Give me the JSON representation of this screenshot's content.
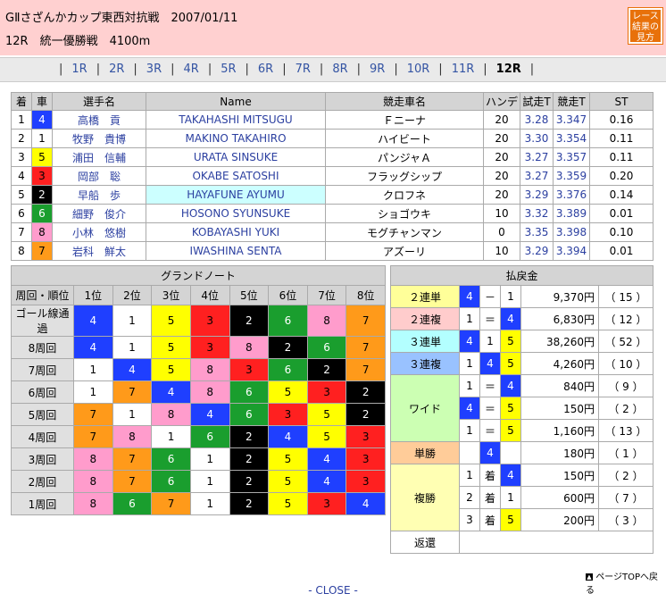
{
  "header": {
    "title": "GⅡさざんかカップ東西対抗戦　2007/01/11",
    "subtitle": "12R　統一優勝戦　4100m",
    "guide_label": "レース結果の見方"
  },
  "race_nav": {
    "races": [
      "1R",
      "2R",
      "3R",
      "4R",
      "5R",
      "6R",
      "7R",
      "8R",
      "9R",
      "10R",
      "11R",
      "12R"
    ],
    "current": "12R"
  },
  "entries": {
    "headers": [
      "着",
      "車",
      "選手名",
      "Name",
      "競走車名",
      "ハンデ",
      "試走T",
      "競走T",
      "ST"
    ],
    "rows": [
      {
        "rank": "1",
        "car": "4",
        "name": "高橋　貢",
        "name_en": "TAKAHASHI MITSUGU",
        "bike": "Ｆニーナ",
        "handi": "20",
        "trial": "3.28",
        "race": "3.347",
        "st": "0.16"
      },
      {
        "rank": "2",
        "car": "1",
        "name": "牧野　貴博",
        "name_en": "MAKINO TAKAHIRO",
        "bike": "ハイビート",
        "handi": "20",
        "trial": "3.30",
        "race": "3.354",
        "st": "0.11"
      },
      {
        "rank": "3",
        "car": "5",
        "name": "浦田　信輔",
        "name_en": "URATA SINSUKE",
        "bike": "パンジャＡ",
        "handi": "20",
        "trial": "3.27",
        "race": "3.357",
        "st": "0.11"
      },
      {
        "rank": "4",
        "car": "3",
        "name": "岡部　聡",
        "name_en": "OKABE SATOSHI",
        "bike": "フラッグシップ",
        "handi": "20",
        "trial": "3.27",
        "race": "3.359",
        "st": "0.20"
      },
      {
        "rank": "5",
        "car": "2",
        "name": "早船　歩",
        "name_en": "HAYAFUNE AYUMU",
        "bike": "クロフネ",
        "handi": "20",
        "trial": "3.29",
        "race": "3.376",
        "st": "0.14"
      },
      {
        "rank": "6",
        "car": "6",
        "name": "細野　俊介",
        "name_en": "HOSONO SYUNSUKE",
        "bike": "ショゴウキ",
        "handi": "10",
        "trial": "3.32",
        "race": "3.389",
        "st": "0.01"
      },
      {
        "rank": "7",
        "car": "8",
        "name": "小林　悠樹",
        "name_en": "KOBAYASHI YUKI",
        "bike": "モグチャンマン",
        "handi": "0",
        "trial": "3.35",
        "race": "3.398",
        "st": "0.10"
      },
      {
        "rank": "8",
        "car": "7",
        "name": "岩科　鮮太",
        "name_en": "IWASHINA SENTA",
        "bike": "アズーリ",
        "handi": "10",
        "trial": "3.29",
        "race": "3.394",
        "st": "0.01"
      }
    ]
  },
  "grand_note": {
    "title": "グランドノート",
    "col_label": "周回・順位",
    "positions": [
      "1位",
      "2位",
      "3位",
      "4位",
      "5位",
      "6位",
      "7位",
      "8位"
    ],
    "rows": [
      {
        "label": "ゴール線通過",
        "cars": [
          "4",
          "1",
          "5",
          "3",
          "2",
          "6",
          "8",
          "7"
        ]
      },
      {
        "label": "8周回",
        "cars": [
          "4",
          "1",
          "5",
          "3",
          "8",
          "2",
          "6",
          "7"
        ]
      },
      {
        "label": "7周回",
        "cars": [
          "1",
          "4",
          "5",
          "8",
          "3",
          "6",
          "2",
          "7"
        ]
      },
      {
        "label": "6周回",
        "cars": [
          "1",
          "7",
          "4",
          "8",
          "6",
          "5",
          "3",
          "2"
        ]
      },
      {
        "label": "5周回",
        "cars": [
          "7",
          "1",
          "8",
          "4",
          "6",
          "3",
          "5",
          "2"
        ]
      },
      {
        "label": "4周回",
        "cars": [
          "7",
          "8",
          "1",
          "6",
          "2",
          "4",
          "5",
          "3"
        ]
      },
      {
        "label": "3周回",
        "cars": [
          "8",
          "7",
          "6",
          "1",
          "2",
          "5",
          "4",
          "3"
        ]
      },
      {
        "label": "2周回",
        "cars": [
          "8",
          "7",
          "6",
          "1",
          "2",
          "5",
          "4",
          "3"
        ]
      },
      {
        "label": "1周回",
        "cars": [
          "8",
          "6",
          "7",
          "1",
          "2",
          "5",
          "3",
          "4"
        ]
      }
    ]
  },
  "payout": {
    "title": "払戻金",
    "rentan2": {
      "label": "２連単",
      "a": "4",
      "sep": "－",
      "b": "1",
      "amount": "9,370円",
      "pop": "（ 15 ）"
    },
    "renfuku2": {
      "label": "２連複",
      "a": "1",
      "sep": "＝",
      "b": "4",
      "amount": "6,830円",
      "pop": "（ 12 ）"
    },
    "rentan3": {
      "label": "３連単",
      "a": "4",
      "b": "1",
      "c": "5",
      "amount": "38,260円",
      "pop": "（ 52 ）"
    },
    "renfuku3": {
      "label": "３連複",
      "a": "1",
      "b": "4",
      "c": "5",
      "amount": "4,260円",
      "pop": "（ 10 ）"
    },
    "wide": {
      "label": "ワイド",
      "rows": [
        {
          "a": "1",
          "sep": "＝",
          "b": "4",
          "amount": "840円",
          "pop": "（ 9 ）"
        },
        {
          "a": "4",
          "sep": "＝",
          "b": "5",
          "amount": "150円",
          "pop": "（ 2 ）"
        },
        {
          "a": "1",
          "sep": "＝",
          "b": "5",
          "amount": "1,160円",
          "pop": "（ 13 ）"
        }
      ]
    },
    "tansho": {
      "label": "単勝",
      "a": "4",
      "amount": "180円",
      "pop": "（ 1 ）"
    },
    "fukusho": {
      "label": "複勝",
      "rows": [
        {
          "rank": "1",
          "chaku": "着",
          "car": "4",
          "amount": "150円",
          "pop": "（ 2 ）"
        },
        {
          "rank": "2",
          "chaku": "着",
          "car": "1",
          "amount": "600円",
          "pop": "（ 7 ）"
        },
        {
          "rank": "3",
          "chaku": "着",
          "car": "5",
          "amount": "200円",
          "pop": "（ 3 ）"
        }
      ]
    },
    "henkan": {
      "label": "返還"
    }
  },
  "footer": {
    "page_top": "ページTOPへ戻る",
    "close": "- CLOSE -"
  }
}
